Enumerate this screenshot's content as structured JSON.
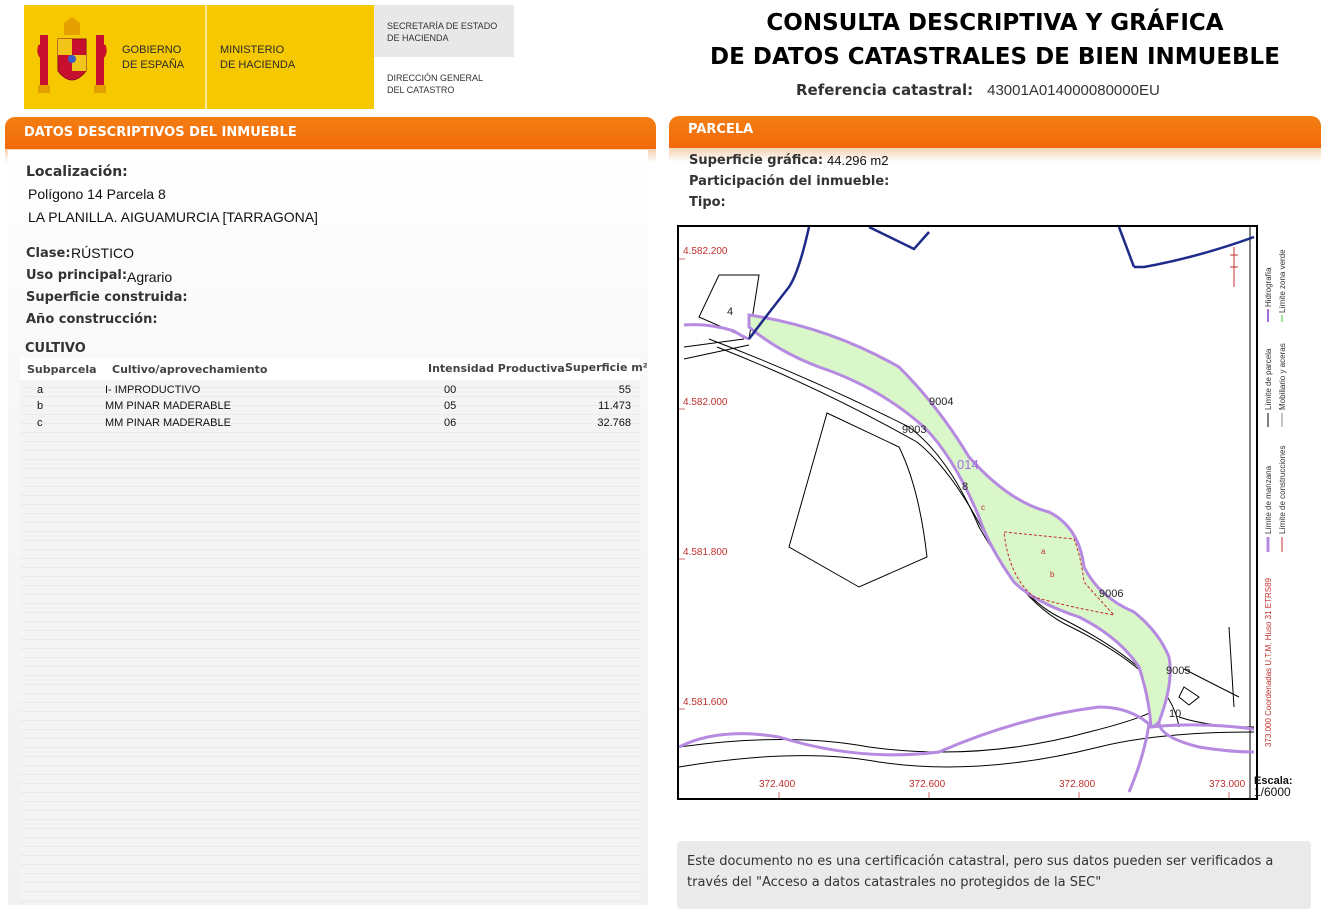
{
  "header": {
    "gobierno_line1": "GOBIERNO",
    "gobierno_line2": "DE ESPAÑA",
    "ministerio_line1": "MINISTERIO",
    "ministerio_line2": "DE HACIENDA",
    "secretaria_line1": "SECRETARÍA DE ESTADO",
    "secretaria_line2": "DE HACIENDA",
    "direccion_line1": "DIRECCIÓN GENERAL",
    "direccion_line2": "DEL CATASTRO",
    "title_line1": "CONSULTA DESCRIPTIVA Y GRÁFICA",
    "title_line2": "DE DATOS CATASTRALES DE BIEN INMUEBLE",
    "ref_label": "Referencia catastral:",
    "ref_value": "43001A014000080000EU",
    "brand_color": "#f6c800",
    "accent_color": "#f26a0a"
  },
  "descriptivos": {
    "heading": "DATOS DESCRIPTIVOS DEL INMUEBLE",
    "localizacion_label": "Localización:",
    "localizacion_line1": "Polígono 14 Parcela 8",
    "localizacion_line2": "LA PLANILLA. AIGUAMURCIA [TARRAGONA]",
    "clase_label": "Clase:",
    "clase_value": "RÚSTICO",
    "uso_label": "Uso principal:",
    "uso_value": "Agrario",
    "superficie_label": "Superficie construida:",
    "anio_label": "Año construcción:"
  },
  "cultivo": {
    "heading": "CULTIVO",
    "columns": [
      "Subparcela",
      "Cultivo/aprovechamiento",
      "Intensidad Productiva",
      "Superficie m²"
    ],
    "rows": [
      {
        "sub": "a",
        "cultivo": "I- IMPRODUCTIVO",
        "intensidad": "00",
        "superficie": "55"
      },
      {
        "sub": "b",
        "cultivo": "MM PINAR MADERABLE",
        "intensidad": "05",
        "superficie": "11.473"
      },
      {
        "sub": "c",
        "cultivo": "MM PINAR MADERABLE",
        "intensidad": "06",
        "superficie": "32.768"
      }
    ]
  },
  "parcela": {
    "heading": "PARCELA",
    "superficie_label": "Superficie gráfica:",
    "superficie_value": "44.296 m2",
    "participacion_label": "Participación del inmueble:",
    "tipo_label": "Tipo:"
  },
  "map": {
    "y_coords": [
      "4.582.200",
      "4.582.000",
      "4.581.800",
      "4.581.600"
    ],
    "x_coords": [
      "372.400",
      "372.600",
      "372.800",
      "373.000"
    ],
    "labels": {
      "poly": "014",
      "parcel": "8",
      "sub_c": "c",
      "sub_a": "a",
      "sub_b": "b",
      "p4": "4",
      "p10": "10",
      "r9004": "9004",
      "r9003": "9003",
      "r9006": "9006",
      "r9005": "9005"
    },
    "legend": {
      "hidrografia": "Hidrografía",
      "limite_zona_verde": "Límite zona verde",
      "limite_parcela": "Límite de parcela",
      "mobiliario": "Mobiliario y aceras",
      "limite_manzana": "Límite de manzana",
      "limite_construcciones": "Límite de construcciones",
      "coords": "373.000 Coordenadas U.T.M. Huso 31 ETRS89"
    },
    "scale_label": "Escala:",
    "scale_value": "1/6000",
    "parcel_fill_color": "#d9f7c8",
    "road_color": "#b58ae0",
    "hydro_color": "#1e2a8a",
    "coord_color": "#c0302c"
  },
  "note": {
    "text": "Este documento no es una certificación catastral, pero sus datos pueden ser verificados a través del \"Acceso a datos catastrales no protegidos de la SEC\""
  }
}
